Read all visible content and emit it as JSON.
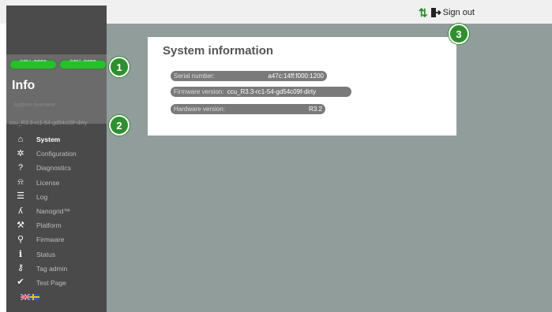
{
  "outlets": [
    {
      "label": "Outlet 1 - Available",
      "color": "#27c02a"
    },
    {
      "label": "Outlet 2 - Available",
      "color": "#27c02a"
    }
  ],
  "sidebar": {
    "title": "Info",
    "subtitle": "System overview",
    "version": "ccu_R3.3-rc1-54-gd54c09f-dirty",
    "items": [
      {
        "label": "System",
        "icon": "home-icon",
        "active": true
      },
      {
        "label": "Configuration",
        "icon": "gear-icon",
        "active": false
      },
      {
        "label": "Diagnostics",
        "icon": "question-icon",
        "active": false
      },
      {
        "label": "License",
        "icon": "lock-icon",
        "active": false
      },
      {
        "label": "Log",
        "icon": "list-icon",
        "active": false
      },
      {
        "label": "Nanogrid™",
        "icon": "nanogrid-icon",
        "active": false
      },
      {
        "label": "Platform",
        "icon": "wrench-icon",
        "active": false
      },
      {
        "label": "Firmware",
        "icon": "chip-icon",
        "active": false
      },
      {
        "label": "Status",
        "icon": "info-icon",
        "active": false
      },
      {
        "label": "Tag admin",
        "icon": "tag-icon",
        "active": false
      },
      {
        "label": "Test Page",
        "icon": "check-icon",
        "active": false
      }
    ],
    "languages": [
      "English",
      "Svenska"
    ]
  },
  "header": {
    "signout_label": "Sign out"
  },
  "system_info": {
    "title": "System information",
    "serial_label": "Serial number:",
    "serial_value": "a47c:14ff:f000:1200",
    "firmware_label": "Firmware version:",
    "firmware_value": "ccu_R3.3-rc1-54-gd54c09f-dirty",
    "hardware_label": "Hardware version:",
    "hardware_value": "R3.2"
  },
  "callouts": [
    "1",
    "2",
    "3"
  ],
  "colors": {
    "accent": "#2f8f2f",
    "outlet_ok": "#27c02a",
    "sidebar_bg": "#4a4a4a",
    "main_bg": "#909d9b"
  }
}
